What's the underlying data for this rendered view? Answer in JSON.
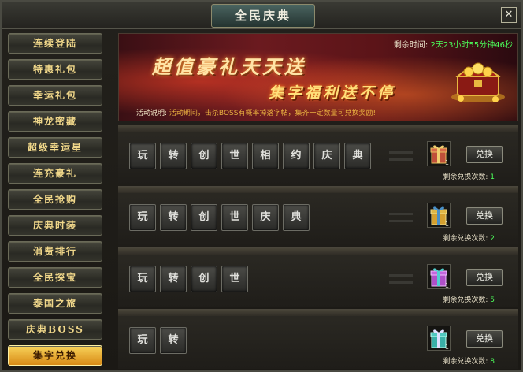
{
  "window": {
    "title": "全民庆典",
    "close_glyph": "✕"
  },
  "sidebar": {
    "items": [
      {
        "label": "连续登陆"
      },
      {
        "label": "特惠礼包"
      },
      {
        "label": "幸运礼包"
      },
      {
        "label": "神龙密藏"
      },
      {
        "label": "超级幸运星"
      },
      {
        "label": "连充豪礼"
      },
      {
        "label": "全民抢购"
      },
      {
        "label": "庆典时装"
      },
      {
        "label": "消费排行"
      },
      {
        "label": "全民探宝"
      },
      {
        "label": "泰国之旅"
      },
      {
        "label": "庆典BOSS"
      },
      {
        "label": "集字兑换"
      }
    ],
    "active_index": 12
  },
  "banner": {
    "time_label": "剩余时间:",
    "time_value": "2天23小时55分钟46秒",
    "slogan_main": "超值豪礼天天送",
    "slogan_sub": "集字福利送不停",
    "desc_label": "活动说明:",
    "desc_text": "活动期间，击杀BOSS有概率掉落字帖，集齐一定数量可兑换奖励!"
  },
  "exchange_rows": [
    {
      "chars": [
        "玩",
        "转",
        "创",
        "世",
        "相",
        "约",
        "庆",
        "典"
      ],
      "gift_count": "1",
      "button_label": "兑换",
      "remain_label": "剩余兑换次数:",
      "remain_value": "1",
      "gift_color": "#c0503a"
    },
    {
      "chars": [
        "玩",
        "转",
        "创",
        "世",
        "庆",
        "典"
      ],
      "gift_count": "1",
      "button_label": "兑换",
      "remain_label": "剩余兑换次数:",
      "remain_value": "2",
      "gift_color": "#d4a030"
    },
    {
      "chars": [
        "玩",
        "转",
        "创",
        "世"
      ],
      "gift_count": "1",
      "button_label": "兑换",
      "remain_label": "剩余兑换次数:",
      "remain_value": "5",
      "gift_color": "#b050c8"
    },
    {
      "chars": [
        "玩",
        "转"
      ],
      "gift_count": "1",
      "button_label": "兑换",
      "remain_label": "剩余兑换次数:",
      "remain_value": "8",
      "gift_color": "#3ab0a8"
    }
  ]
}
